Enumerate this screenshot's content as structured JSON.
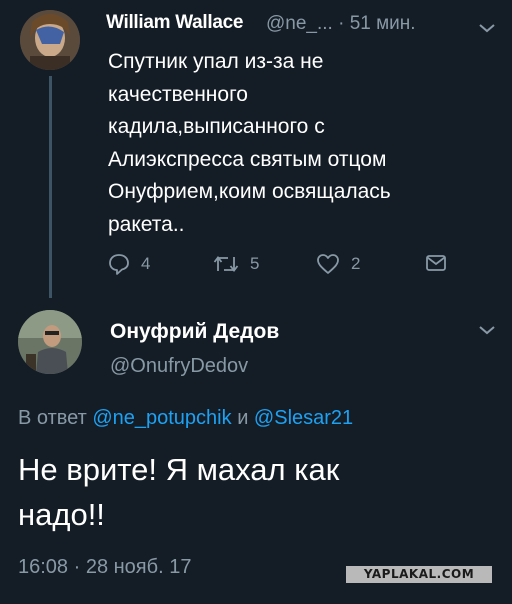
{
  "tweet1": {
    "author_name": "William Wallace",
    "meta": "@ne_... · 51 мин.",
    "lines": [
      "Спутник упал из-за не",
      "качественного",
      "кадила,выписанного с",
      "Алиэкспресса святым отцом",
      "Онуфрием,коим освящалась",
      "ракета.."
    ],
    "replies": "4",
    "retweets": "5",
    "likes": "2"
  },
  "tweet2": {
    "author_name": "Онуфрий Дедов",
    "handle": "@OnufryDedov",
    "reply_prefix": "В ответ",
    "reply_user1": "@ne_potupchik",
    "reply_and": "и",
    "reply_user2": "@Slesar21",
    "lines": [
      "Не врите! Я махал как",
      "надо!!"
    ],
    "timestamp": "16:08 · 28 нояб. 17"
  },
  "watermark": "YAPLAKAL.COM",
  "colors": {
    "background": "#141d26",
    "secondary_text": "#8899a6",
    "link": "#1da1f2"
  }
}
